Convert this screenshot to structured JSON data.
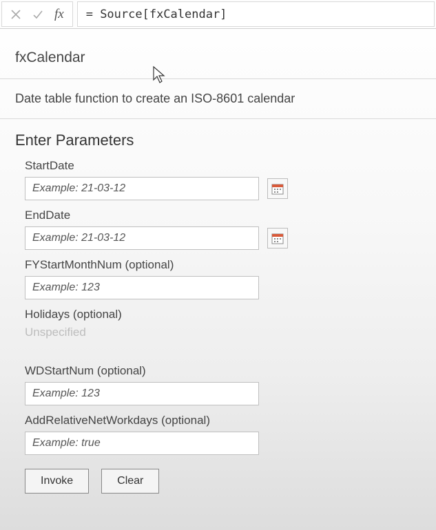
{
  "formulaBar": {
    "fxLabel": "fx",
    "formula": "= Source[fxCalendar]"
  },
  "function": {
    "name": "fxCalendar",
    "description": "Date table function to create an ISO-8601 calendar"
  },
  "section": {
    "title": "Enter Parameters"
  },
  "params": {
    "startDate": {
      "label": "StartDate",
      "placeholder": "Example: 21-03-12"
    },
    "endDate": {
      "label": "EndDate",
      "placeholder": "Example: 21-03-12"
    },
    "fyStartMonthNum": {
      "label": "FYStartMonthNum (optional)",
      "placeholder": "Example: 123"
    },
    "holidays": {
      "label": "Holidays (optional)",
      "unspecified": "Unspecified"
    },
    "wdStartNum": {
      "label": "WDStartNum (optional)",
      "placeholder": "Example: 123"
    },
    "addRelativeNetWorkdays": {
      "label": "AddRelativeNetWorkdays (optional)",
      "placeholder": "Example: true"
    }
  },
  "buttons": {
    "invoke": "Invoke",
    "clear": "Clear"
  }
}
